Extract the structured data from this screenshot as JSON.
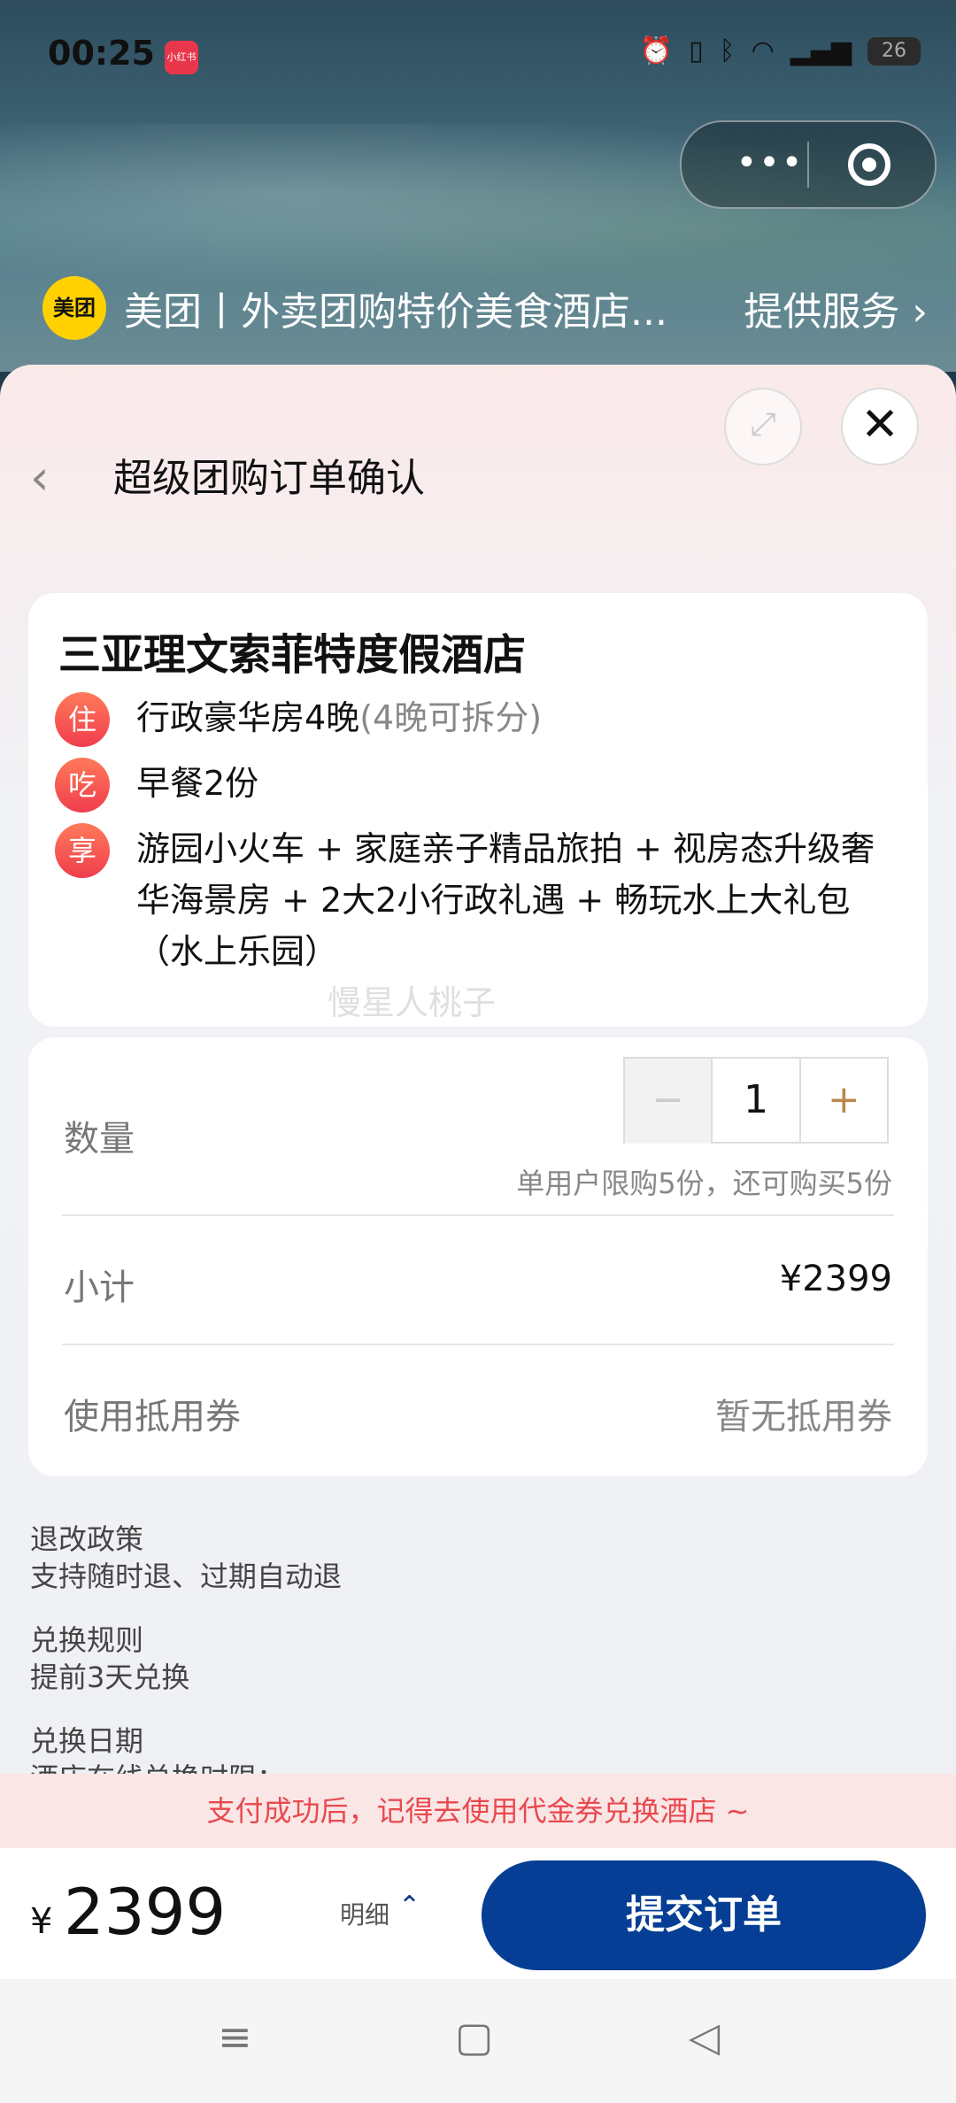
{
  "status_bar": {
    "time": "00:25",
    "app_logo": "小红书",
    "icons": [
      "alarm-icon",
      "vibrate-icon",
      "bluetooth-icon",
      "wifi-icon",
      "5g-signal-icon"
    ],
    "battery": "26"
  },
  "capsule": {
    "more": "•••"
  },
  "mini_app": {
    "logo": "美团",
    "name": "美团丨外卖团购特价美食酒店...",
    "service": "提供服务 ›"
  },
  "sheet": {
    "expand_icon": "⤢",
    "close_icon": "✕",
    "back_icon": "‹",
    "title": "超级团购订单确认"
  },
  "hotel": {
    "name": "三亚理文索菲特度假酒店",
    "items": [
      {
        "badge": "住",
        "text": "行政豪华房4晚",
        "note": "(4晚可拆分)"
      },
      {
        "badge": "吃",
        "text": "早餐2份",
        "note": ""
      },
      {
        "badge": "享",
        "text": "游园小火车 + 家庭亲子精品旅拍 + 视房态升级奢华海景房 + 2大2小行政礼遇 + 畅玩水上大礼包（水上乐园）",
        "note": ""
      }
    ],
    "watermark": "慢星人桃子"
  },
  "order": {
    "quantity_label": "数量",
    "minus": "−",
    "quantity": "1",
    "plus": "+",
    "limit_text": "单用户限购5份，还可购买5份",
    "subtotal_label": "小计",
    "subtotal": "¥2399",
    "coupon_label": "使用抵用券",
    "coupon_value": "暂无抵用券"
  },
  "policies": [
    {
      "title": "退改政策",
      "text": "支持随时退、过期自动退"
    },
    {
      "title": "兑换规则",
      "text": "提前3天兑换"
    },
    {
      "title": "兑换日期",
      "text": "酒店在线兑换时限："
    }
  ],
  "notice": "支付成功后，记得去使用代金券兑换酒店 ~",
  "bottom": {
    "currency": "¥",
    "total": "2399",
    "detail": "明细",
    "detail_chevron": "⌃",
    "submit": "提交订单"
  },
  "nav": {
    "menu": "≡",
    "home": "▢",
    "back": "◁"
  }
}
